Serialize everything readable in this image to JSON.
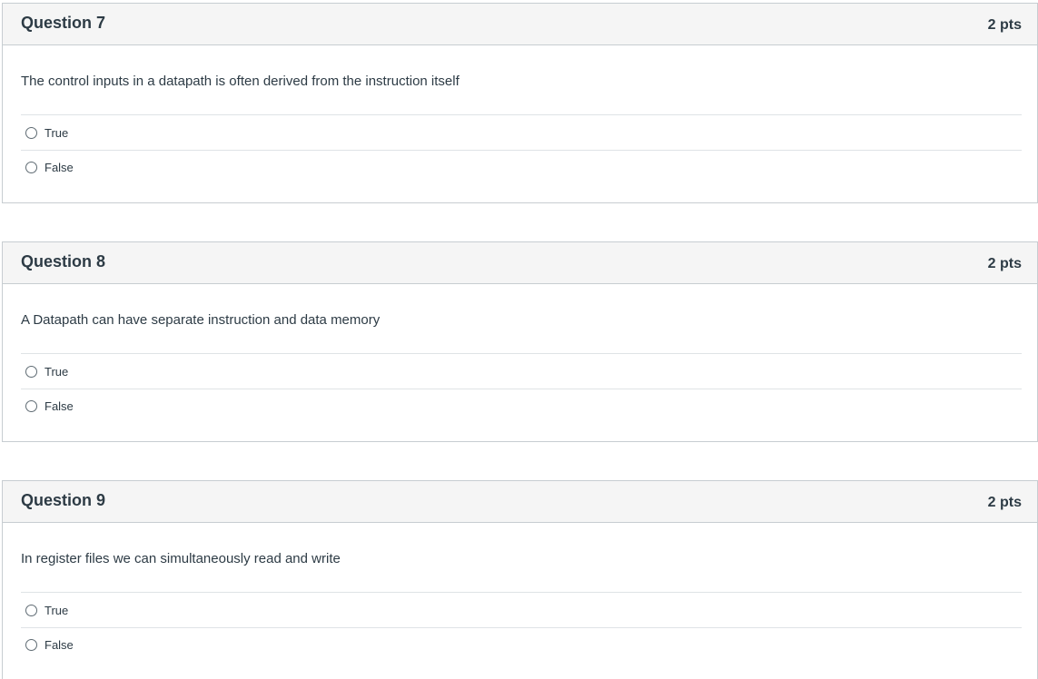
{
  "questions": [
    {
      "title": "Question 7",
      "points": "2 pts",
      "text": "The control inputs in a datapath is often derived from the instruction itself",
      "answers": [
        "True",
        "False"
      ]
    },
    {
      "title": "Question 8",
      "points": "2 pts",
      "text": "A Datapath can have separate instruction and data memory",
      "answers": [
        "True",
        "False"
      ]
    },
    {
      "title": "Question 9",
      "points": "2 pts",
      "text": "In register files we can simultaneously read and write",
      "answers": [
        "True",
        "False"
      ]
    }
  ]
}
